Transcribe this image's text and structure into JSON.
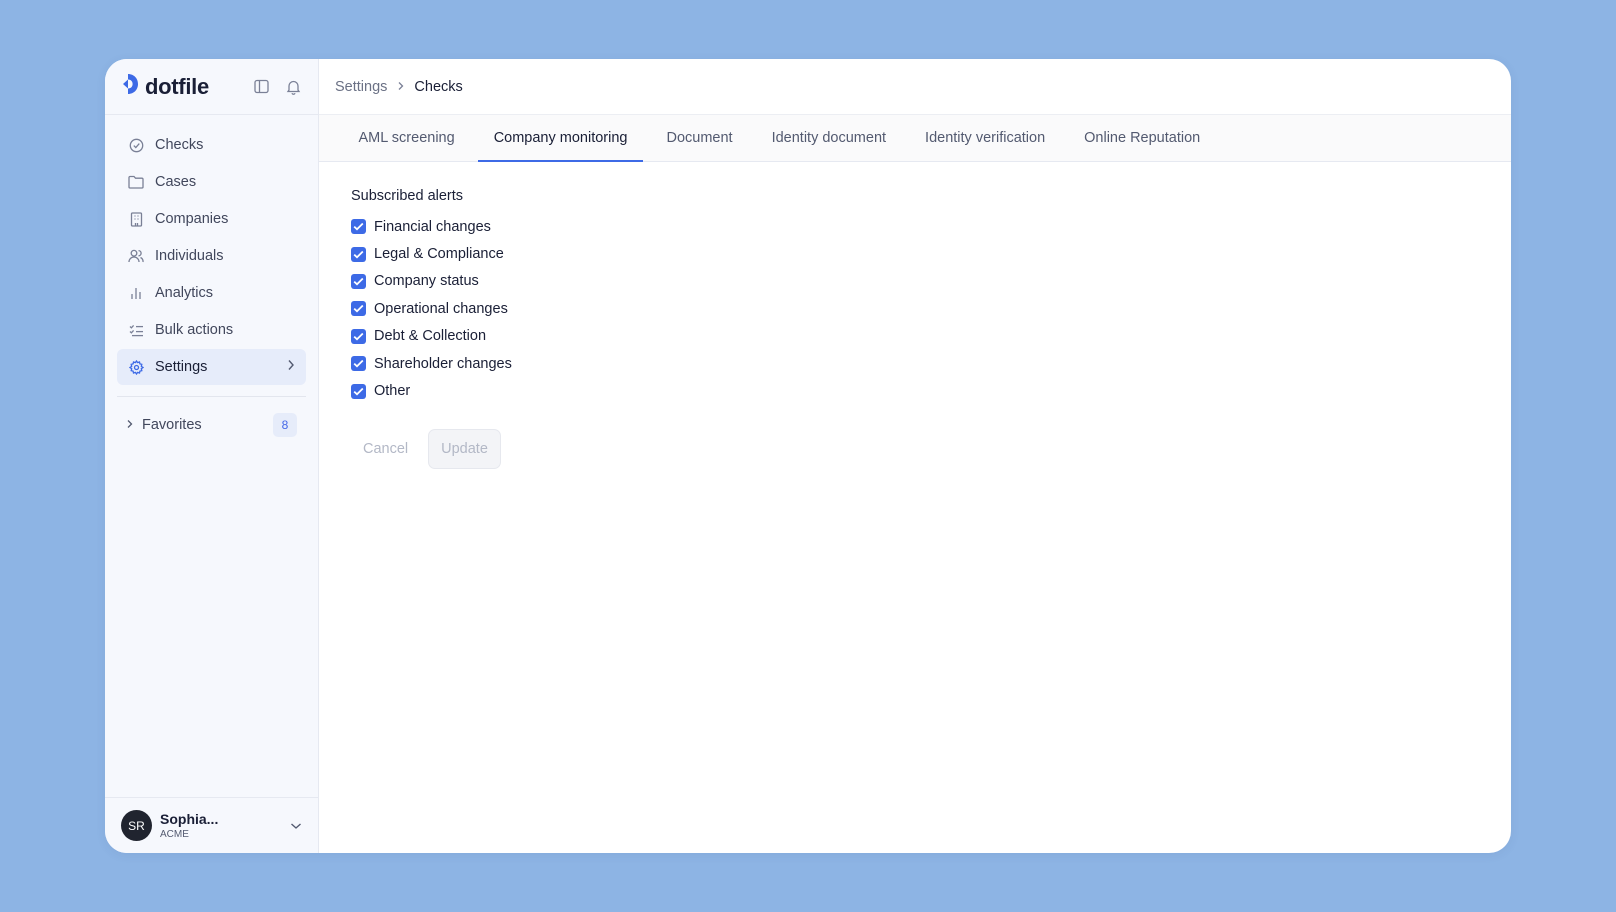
{
  "app": {
    "brand": "dotfile",
    "accent_color": "#3d6ae6"
  },
  "sidebar": {
    "items": [
      {
        "label": "Checks",
        "icon": "check-circle-icon"
      },
      {
        "label": "Cases",
        "icon": "folder-icon"
      },
      {
        "label": "Companies",
        "icon": "building-icon"
      },
      {
        "label": "Individuals",
        "icon": "users-icon"
      },
      {
        "label": "Analytics",
        "icon": "bar-chart-icon"
      },
      {
        "label": "Bulk actions",
        "icon": "list-checks-icon"
      },
      {
        "label": "Settings",
        "icon": "gear-icon",
        "active": true
      }
    ],
    "favorites": {
      "label": "Favorites",
      "count": "8"
    },
    "user": {
      "initials": "SR",
      "name": "Sophia...",
      "org": "ACME"
    }
  },
  "breadcrumb": {
    "parent": "Settings",
    "current": "Checks"
  },
  "tabs": [
    {
      "label": "AML screening"
    },
    {
      "label": "Company monitoring",
      "active": true
    },
    {
      "label": "Document"
    },
    {
      "label": "Identity document"
    },
    {
      "label": "Identity verification"
    },
    {
      "label": "Online Reputation"
    }
  ],
  "alerts": {
    "title": "Subscribed alerts",
    "options": [
      {
        "label": "Financial changes",
        "checked": true
      },
      {
        "label": "Legal & Compliance",
        "checked": true
      },
      {
        "label": "Company status",
        "checked": true
      },
      {
        "label": "Operational changes",
        "checked": true
      },
      {
        "label": "Debt & Collection",
        "checked": true
      },
      {
        "label": "Shareholder changes",
        "checked": true
      },
      {
        "label": "Other",
        "checked": true
      }
    ]
  },
  "actions": {
    "cancel": "Cancel",
    "update": "Update"
  }
}
